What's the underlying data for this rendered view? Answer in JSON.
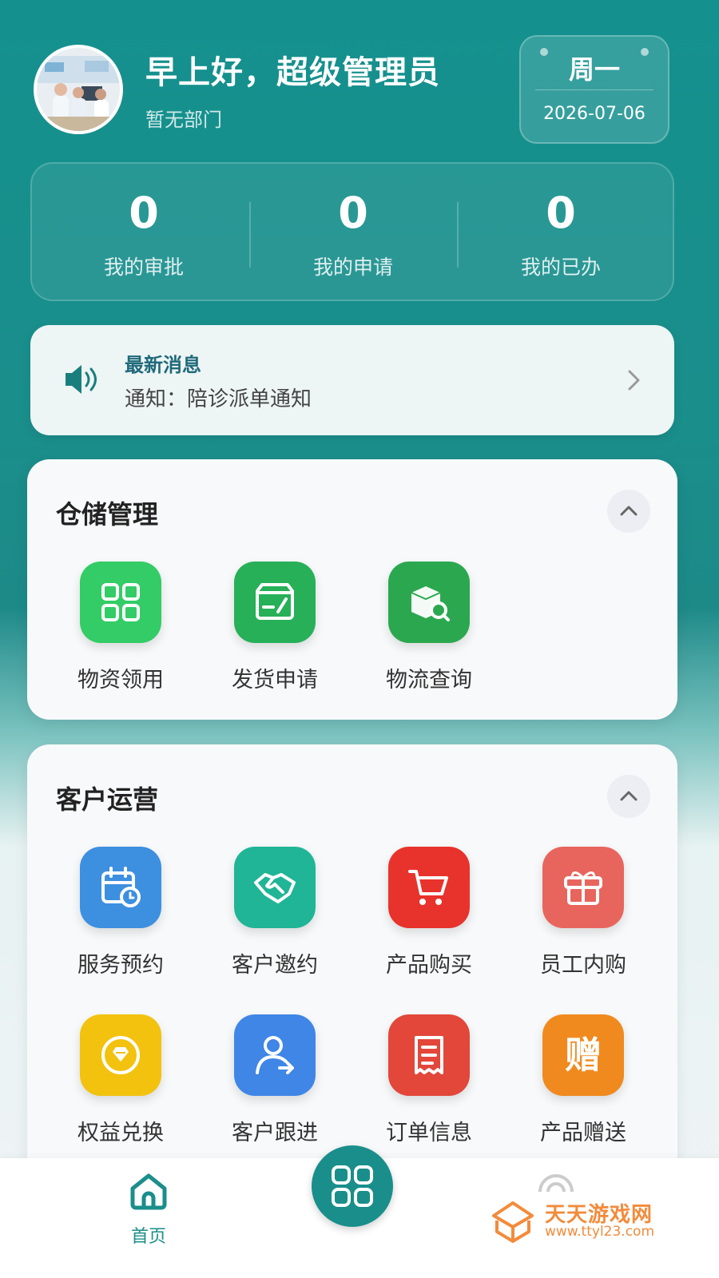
{
  "header": {
    "greeting": "早上好，超级管理员",
    "department": "暂无部门",
    "weekday": "周一",
    "date": "2026-07-06"
  },
  "stats": [
    {
      "value": "0",
      "label": "我的审批"
    },
    {
      "value": "0",
      "label": "我的申请"
    },
    {
      "value": "0",
      "label": "我的已办"
    }
  ],
  "news": {
    "title": "最新消息",
    "text": "通知：陪诊派单通知"
  },
  "warehouse": {
    "title": "仓储管理",
    "items": [
      {
        "label": "物资领用",
        "icon": "grid-icon",
        "color": "#33cc66"
      },
      {
        "label": "发货申请",
        "icon": "box-edit-icon",
        "color": "#27b058"
      },
      {
        "label": "物流查询",
        "icon": "package-search-icon",
        "color": "#2ba84f"
      }
    ]
  },
  "customer": {
    "title": "客户运营",
    "items": [
      {
        "label": "服务预约",
        "icon": "calendar-clock-icon",
        "color": "#3d8fe0"
      },
      {
        "label": "客户邀约",
        "icon": "handshake-icon",
        "color": "#1fb596"
      },
      {
        "label": "产品购买",
        "icon": "cart-icon",
        "color": "#e8322c"
      },
      {
        "label": "员工内购",
        "icon": "gift-icon",
        "color": "#e8655e"
      },
      {
        "label": "权益兑换",
        "icon": "diamond-coin-icon",
        "color": "#f2c20f"
      },
      {
        "label": "客户跟进",
        "icon": "user-arrow-icon",
        "color": "#3f86e6"
      },
      {
        "label": "订单信息",
        "icon": "receipt-icon",
        "color": "#e2473a"
      },
      {
        "label": "产品赠送",
        "icon": "gift-char-icon",
        "color": "#f08a1f",
        "glyph": "赠"
      }
    ]
  },
  "nav": {
    "home_label": "首页"
  },
  "watermark": {
    "name": "天天游戏网",
    "url": "www.ttyl23.com"
  }
}
